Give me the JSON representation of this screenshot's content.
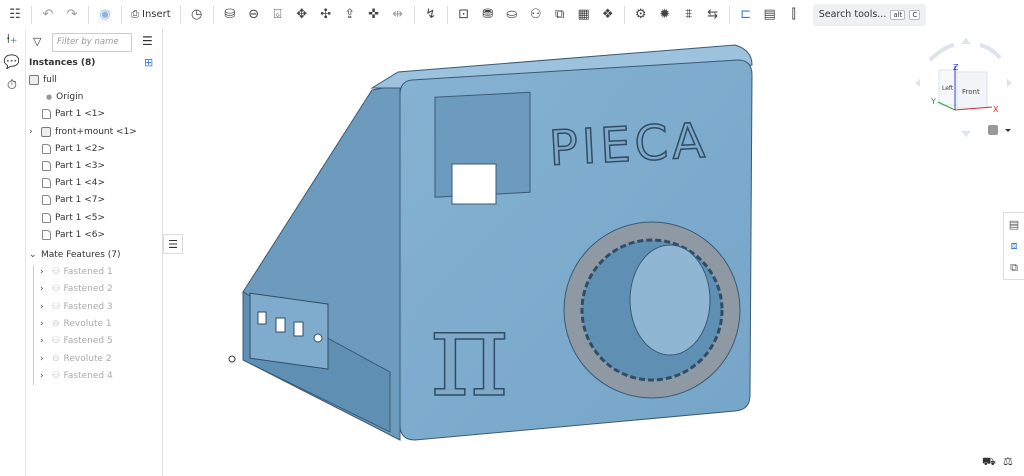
{
  "toolbar": {
    "insert_label": "Insert",
    "search_label": "Search tools...",
    "search_kbd1": "alt",
    "search_kbd2": "C",
    "icons": [
      "feature-list-icon",
      "undo-icon",
      "redo-icon",
      "cursor-icon",
      "insert-icon",
      "timeline-icon",
      "fastened-mate-icon",
      "revolute-mate-icon",
      "slider-mate-icon",
      "planar-mate-icon",
      "cylindrical-mate-icon",
      "pin-slot-mate-icon",
      "ball-mate-icon",
      "parallel-mate-icon",
      "tangent-mate-icon",
      "mate-connector-icon",
      "group-icon",
      "replicate-icon",
      "pattern-icon",
      "linear-pattern-icon",
      "circular-pattern-icon",
      "explode-icon",
      "gear-relation-icon",
      "rack-pinion-icon",
      "screw-relation-icon",
      "linear-relation-icon",
      "section-icon",
      "measure-icon",
      "mass-icon"
    ]
  },
  "panel": {
    "filter_placeholder": "Filter by name",
    "instances_header": "Instances (8)",
    "instances": [
      {
        "label": "full",
        "type": "assembly",
        "indent": 0
      },
      {
        "label": "Origin",
        "type": "origin",
        "indent": 1
      },
      {
        "label": "Part 1 <1>",
        "type": "part",
        "indent": 1
      },
      {
        "label": "front+mount <1>",
        "type": "assembly",
        "indent": 1,
        "expandable": true
      },
      {
        "label": "Part 1 <2>",
        "type": "part",
        "indent": 1
      },
      {
        "label": "Part 1 <3>",
        "type": "part",
        "indent": 1
      },
      {
        "label": "Part 1 <4>",
        "type": "part",
        "indent": 1
      },
      {
        "label": "Part 1 <7>",
        "type": "part",
        "indent": 1
      },
      {
        "label": "Part 1 <5>",
        "type": "part",
        "indent": 1
      },
      {
        "label": "Part 1 <6>",
        "type": "part",
        "indent": 1
      }
    ],
    "mates_header": "Mate Features (7)",
    "mates": [
      "Fastened 1",
      "Fastened 2",
      "Fastened 3",
      "Revolute 1",
      "Fastened 5",
      "Revolute 2",
      "Fastened 4"
    ]
  },
  "viewcube": {
    "top": "Z",
    "left_face": "Left",
    "front_face": "Front",
    "x": "X",
    "y": "Y"
  },
  "model": {
    "title_text": "PIECA",
    "symbol_text": "π",
    "color": "#7faccd"
  }
}
